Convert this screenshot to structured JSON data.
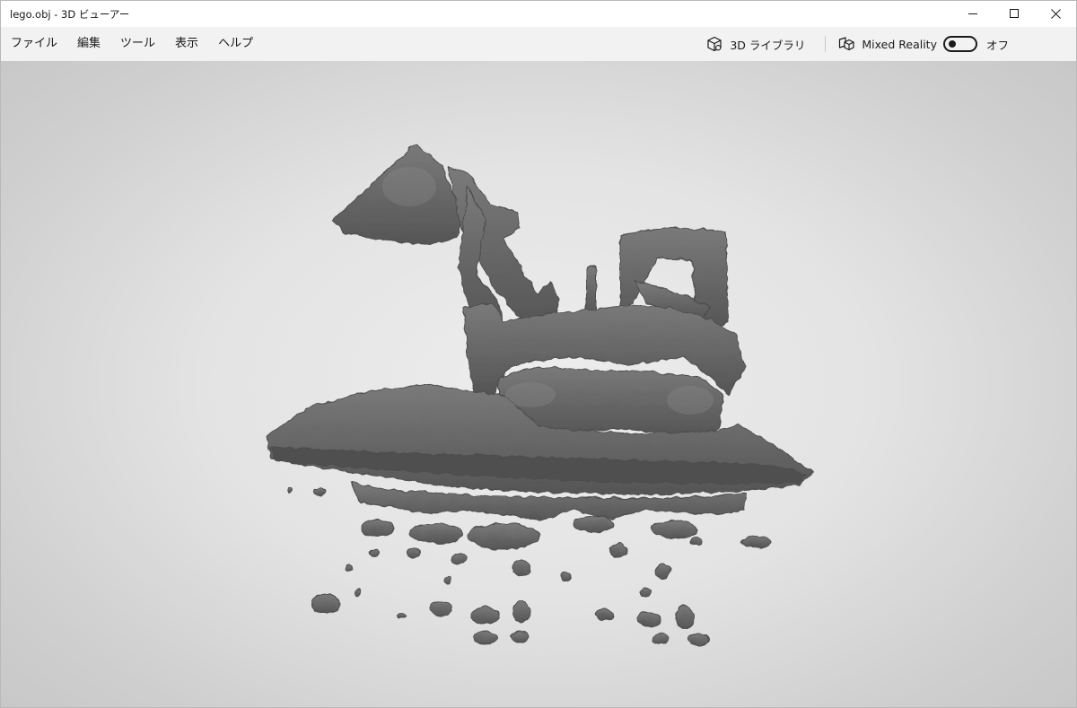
{
  "window": {
    "title": "lego.obj - 3D ビューアー"
  },
  "caption_buttons": {
    "minimize_icon": "minimize-icon",
    "maximize_icon": "maximize-icon",
    "close_icon": "close-icon"
  },
  "menu": {
    "items": [
      {
        "label": "ファイル"
      },
      {
        "label": "編集"
      },
      {
        "label": "ツール"
      },
      {
        "label": "表示"
      },
      {
        "label": "ヘルプ"
      }
    ]
  },
  "toolbar": {
    "library_label": "3D ライブラリ",
    "library_icon": "cube-icon",
    "mixed_reality_label": "Mixed Reality",
    "mixed_reality_icon": "mixed-reality-icon",
    "toggle_state_label": "オフ",
    "toggle_on": false
  },
  "viewport": {
    "model_color": "#5f5f5f",
    "background_center": "#ededed",
    "background_edge": "#c7c7c7"
  }
}
